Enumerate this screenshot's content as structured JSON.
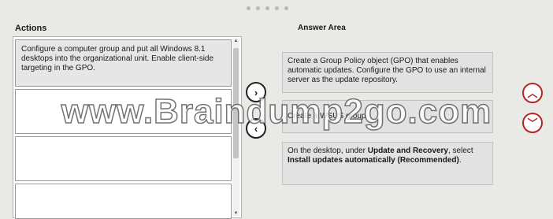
{
  "header": {
    "pager_dots": 5
  },
  "actions": {
    "title": "Actions",
    "items": [
      {
        "text": "Configure a computer group and put all Windows 8.1 desktops into the organizational unit. Enable client-side targeting in the GPO."
      },
      {
        "text": ""
      },
      {
        "text": ""
      },
      {
        "text": ""
      }
    ]
  },
  "answer": {
    "title": "Answer Area",
    "items": [
      {
        "text": "Create a Group Policy object (GPO) that enables automatic updates. Configure the GPO to use an internal server as the update repository."
      },
      {
        "text": "Create a WSUS group."
      },
      {
        "part1": "On the desktop, under ",
        "bold1": "Update and Recovery",
        "part2": ", select ",
        "bold2": "Install updates automatically (Recommended)",
        "part3": "."
      }
    ]
  },
  "controls": {
    "move_right_icon": "chevron-right-icon",
    "move_left_icon": "chevron-left-icon",
    "move_up_icon": "chevron-up-icon",
    "move_down_icon": "chevron-down-icon",
    "move_right_glyph": "›",
    "move_left_glyph": "‹",
    "move_up_glyph": "︿",
    "move_down_glyph": "﹀"
  },
  "watermark": {
    "text": "www.Braindump2go.com"
  },
  "colors": {
    "order_button": "#b42626",
    "item_fill": "#e2e2e2",
    "background": "#e9e9e6"
  }
}
